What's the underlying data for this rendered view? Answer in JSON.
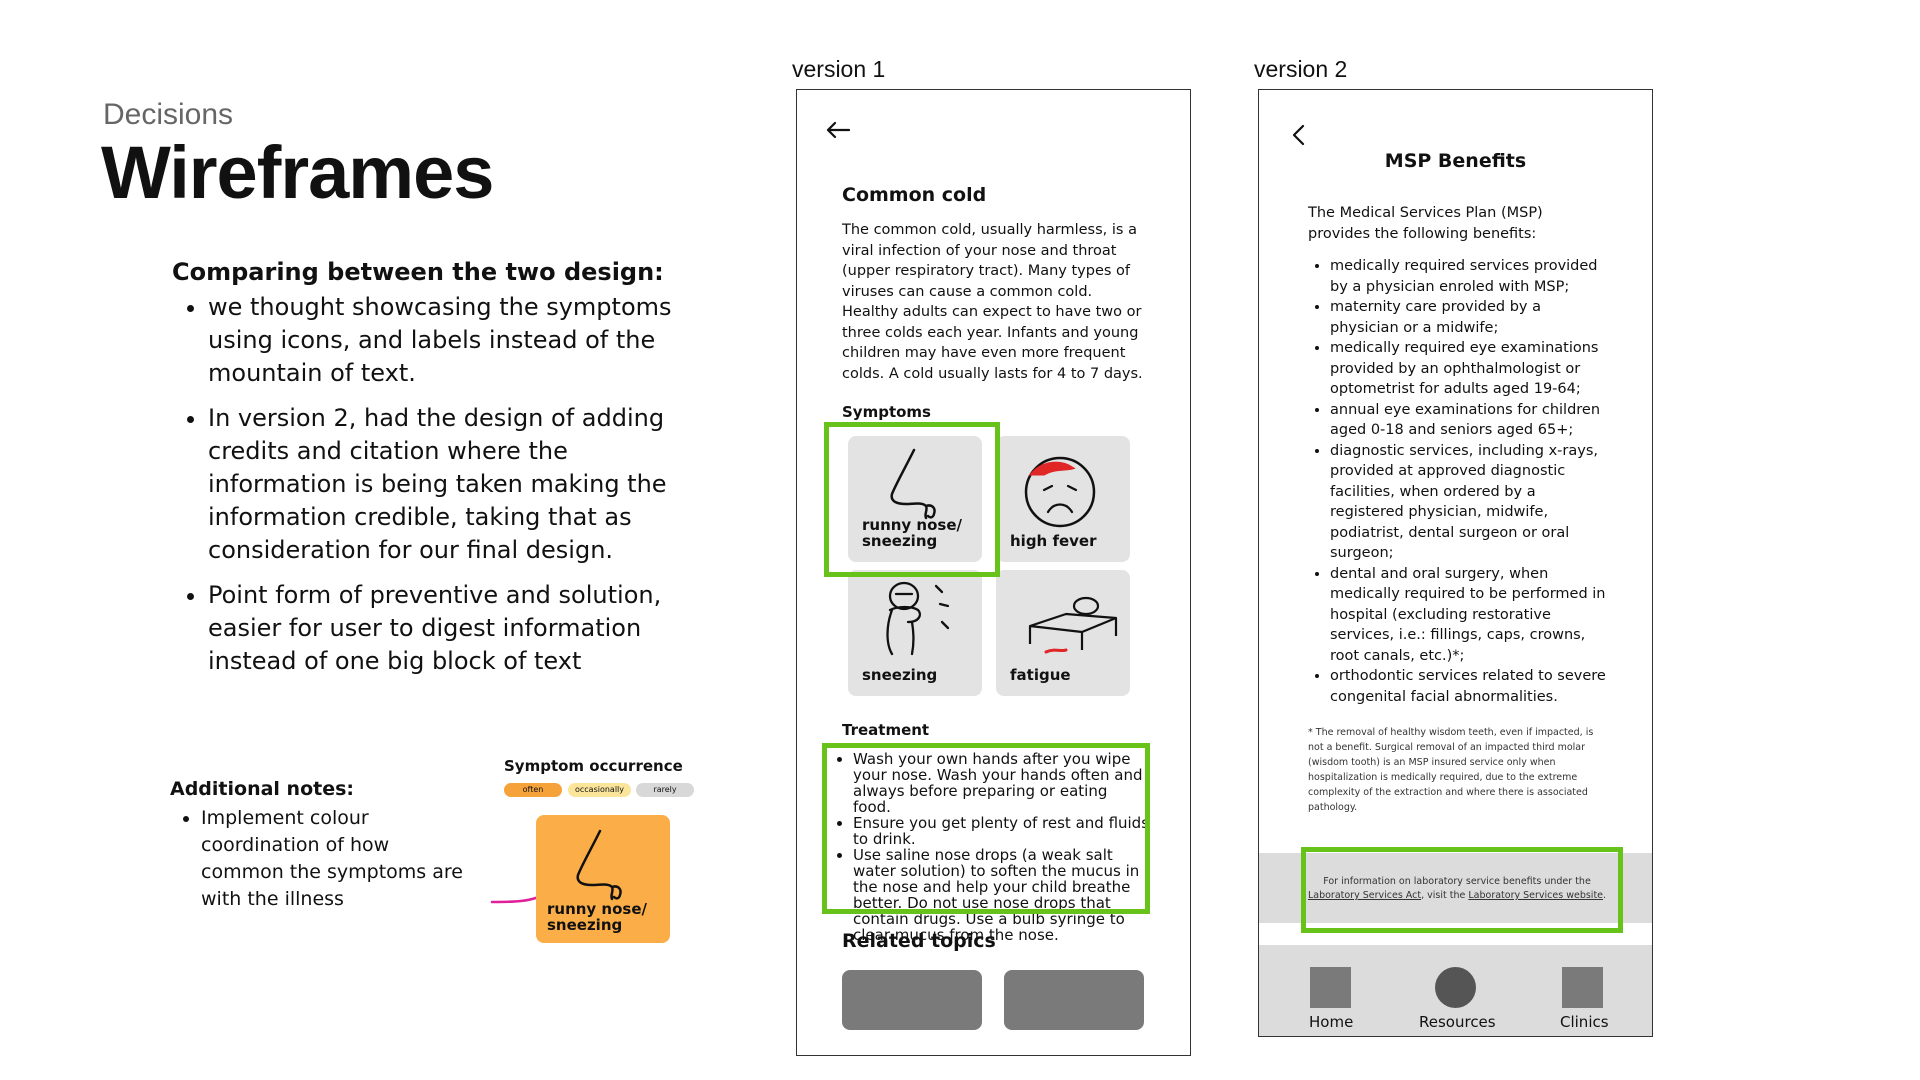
{
  "header": {
    "eyebrow": "Decisions",
    "title": "Wireframes"
  },
  "comparison": {
    "heading": "Comparing between the two design:",
    "points": [
      "we thought showcasing the symptoms using icons, and labels instead of the mountain of text.",
      "In version 2, had the design of adding credits and citation where the information is being taken making the information credible, taking that as consideration for our final design.",
      "Point form of preventive and solution, easier for user to digest information instead of one big block of text"
    ]
  },
  "notes": {
    "heading": "Additional notes:",
    "points": [
      "Implement colour coordination of how common the symptoms are with the illness"
    ]
  },
  "occurrence": {
    "title": "Symptom occurrence",
    "levels": [
      "often",
      "occasionally",
      "rarely"
    ],
    "example_label": "runny nose/ sneezing",
    "colors": {
      "often": "#f6a23b",
      "occasionally": "#fbe59b",
      "rarely": "#d8d8d8"
    }
  },
  "version1": {
    "label": "version 1",
    "back_icon": "arrow-left-icon",
    "heading": "Common cold",
    "body": "The common cold, usually harmless, is a viral infection of your nose and throat (upper respiratory tract). Many types of viruses can cause a common cold. Healthy adults can expect to have two or three colds each year. Infants and young children may have even more frequent colds. A cold usually lasts for 4 to 7 days.",
    "symptoms_title": "Symptoms",
    "symptoms": [
      "runny nose/ sneezing",
      "high fever",
      "sneezing",
      "fatigue"
    ],
    "treatment_title": "Treatment",
    "treatment": [
      "Wash your own hands after you wipe your nose. Wash your hands often and always before preparing or eating food.",
      "Ensure you get plenty of rest and fluids to drink.",
      "Use saline nose drops (a weak salt water solution) to soften the mucus in the nose and help your child breathe better. Do not use nose drops that contain drugs. Use a bulb syringe to clear mucus from the nose."
    ],
    "related_title": "Related topics"
  },
  "version2": {
    "label": "version 2",
    "back_icon": "chevron-left-icon",
    "heading": "MSP Benefits",
    "intro": "The Medical Services Plan (MSP) provides the following benefits:",
    "benefits": [
      "medically required services provided by a physician enroled with MSP;",
      "maternity care provided by a physician or a midwife;",
      "medically required eye examinations provided by an ophthalmologist or optometrist for adults aged 19-64;",
      "annual eye examinations for children aged 0-18 and seniors aged 65+;",
      "diagnostic services, including x-rays, provided at approved diagnostic facilities, when ordered by a registered physician, midwife, podiatrist, dental surgeon or oral surgeon;",
      "dental and oral surgery, when medically required to be performed in hospital (excluding restorative services, i.e.: fillings, caps, crowns, root canals, etc.)*;",
      "orthodontic services related to severe congenital facial abnormalities."
    ],
    "footnote": "* The removal of healthy wisdom teeth, even if impacted, is not a benefit. Surgical removal of an impacted third molar (wisdom tooth) is an MSP insured service only when hospitalization is medically required, due to the extreme complexity of the extraction and where there is associated pathology.",
    "lab_prefix": "For information on laboratory service benefits under the",
    "lab_link1": "Laboratory Services Act",
    "lab_mid": ", visit the",
    "lab_link2": "Laboratory Services website",
    "lab_suffix": ".",
    "nav": [
      "Home",
      "Resources",
      "Clinics"
    ]
  },
  "colors": {
    "highlight": "#67c21a",
    "annotation": "#e0209a"
  }
}
